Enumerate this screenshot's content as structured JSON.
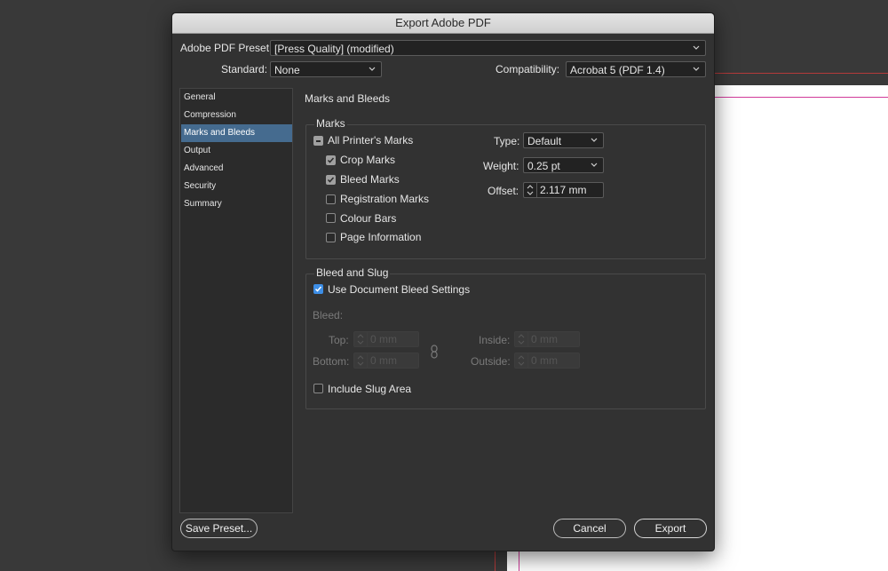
{
  "dialog": {
    "title": "Export Adobe PDF",
    "preset_label": "Adobe PDF Preset:",
    "preset_value": "[Press Quality] (modified)",
    "standard_label": "Standard:",
    "standard_value": "None",
    "compatibility_label": "Compatibility:",
    "compatibility_value": "Acrobat 5 (PDF 1.4)"
  },
  "sidebar": {
    "items": [
      {
        "label": "General"
      },
      {
        "label": "Compression"
      },
      {
        "label": "Marks and Bleeds",
        "active": true
      },
      {
        "label": "Output"
      },
      {
        "label": "Advanced"
      },
      {
        "label": "Security"
      },
      {
        "label": "Summary"
      }
    ]
  },
  "panel": {
    "title": "Marks and Bleeds",
    "marks": {
      "group_label": "Marks",
      "all_printers_marks": "All Printer's Marks",
      "crop_marks": "Crop Marks",
      "bleed_marks": "Bleed Marks",
      "registration_marks": "Registration Marks",
      "colour_bars": "Colour Bars",
      "page_information": "Page Information",
      "type_label": "Type:",
      "type_value": "Default",
      "weight_label": "Weight:",
      "weight_value": "0.25 pt",
      "offset_label": "Offset:",
      "offset_value": "2.117 mm"
    },
    "bleed": {
      "group_label": "Bleed and Slug",
      "use_document_bleed": "Use Document Bleed Settings",
      "bleed_label": "Bleed:",
      "top_label": "Top:",
      "bottom_label": "Bottom:",
      "inside_label": "Inside:",
      "outside_label": "Outside:",
      "top_value": "0 mm",
      "bottom_value": "0 mm",
      "inside_value": "0 mm",
      "outside_value": "0 mm",
      "include_slug": "Include Slug Area"
    }
  },
  "footer": {
    "save_preset": "Save Preset...",
    "cancel": "Cancel",
    "export": "Export"
  },
  "colors": {
    "accent": "#3d8ee6",
    "sidebar_active": "#456b8f",
    "dialog_bg": "#323232"
  }
}
